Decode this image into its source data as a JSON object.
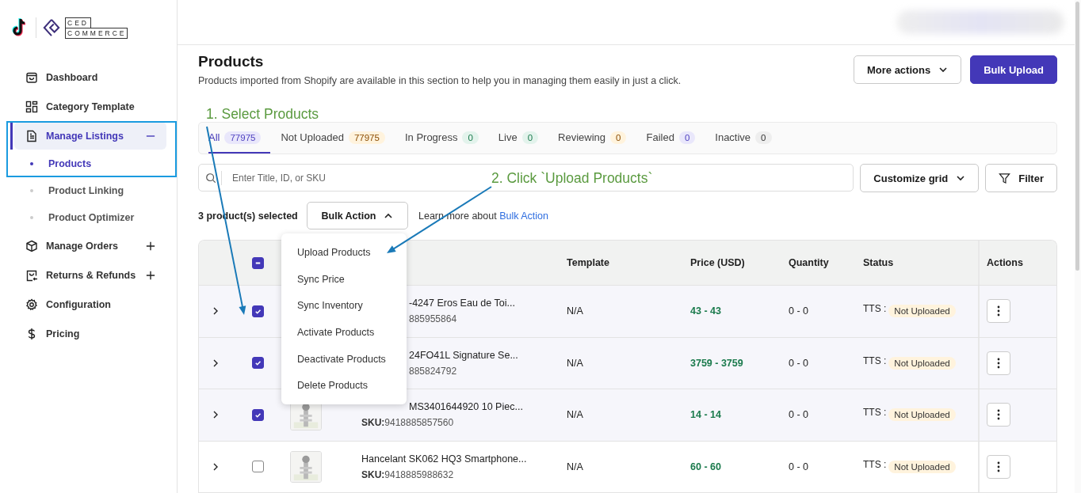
{
  "logo": {
    "line1": "CED",
    "line2": "COMMERCE"
  },
  "sidebar": {
    "items": [
      {
        "label": "Dashboard",
        "selected": false
      },
      {
        "label": "Category Template",
        "selected": false
      },
      {
        "label": "Manage Listings",
        "selected": true,
        "expanded": true,
        "children": [
          {
            "label": "Products",
            "selected": true
          },
          {
            "label": "Product Linking",
            "selected": false
          },
          {
            "label": "Product Optimizer",
            "selected": false
          }
        ]
      },
      {
        "label": "Manage Orders",
        "selected": false,
        "expanded": false
      },
      {
        "label": "Returns & Refunds",
        "selected": false,
        "expanded": false
      },
      {
        "label": "Configuration",
        "selected": false
      },
      {
        "label": "Pricing",
        "selected": false
      }
    ]
  },
  "page": {
    "title": "Products",
    "subtitle": "Products imported from Shopify are available in this section to help you in managing them easily in just a click.",
    "buttons": [
      {
        "label": "More actions",
        "kind": "dropdown"
      },
      {
        "label": "Bulk Upload",
        "kind": "primary"
      }
    ]
  },
  "tabs": [
    {
      "label": "All",
      "count": "77975",
      "selected": true,
      "color": "#e9e7fb"
    },
    {
      "label": "Not Uploaded",
      "count": "77975",
      "selected": false,
      "color": "#fff3dd"
    },
    {
      "label": "In Progress",
      "count": "0",
      "selected": false,
      "color": "#e3f3ec"
    },
    {
      "label": "Live",
      "count": "0",
      "selected": false,
      "color": "#e3f3ec"
    },
    {
      "label": "Reviewing",
      "count": "0",
      "selected": false,
      "color": "#fff3dd"
    },
    {
      "label": "Failed",
      "count": "0",
      "selected": false,
      "color": "#e9e7fb"
    },
    {
      "label": "Inactive",
      "count": "0",
      "selected": false,
      "color": "#eeeeee"
    }
  ],
  "search": {
    "placeholder": "Enter Title, ID, or SKU"
  },
  "toolbar_buttons": [
    {
      "label": "Customize grid",
      "kind": "dropdown"
    },
    {
      "label": "Filter",
      "kind": "filter"
    }
  ],
  "selection": {
    "count_text": "3 product(s) selected",
    "bulk_button": {
      "label": "Bulk Action",
      "expanded": true
    },
    "learn_more": "Learn more about",
    "learn_more_link": "Bulk Action"
  },
  "bulk_menu": [
    "Upload Products",
    "Sync Price",
    "Sync Inventory",
    "Activate Products",
    "Deactivate Products",
    "Delete Products"
  ],
  "table": {
    "select_all_checked": true,
    "select_all_partial": true,
    "columns": [
      "Template",
      "Price (USD)",
      "Quantity",
      "Status",
      "Actions"
    ],
    "rows": [
      {
        "checked": true,
        "image": false,
        "title": "-4247 Eros Eau de Toi...",
        "title_covered": true,
        "sku": "885955864",
        "template": "N/A",
        "price": "43 - 43",
        "quantity": "0 - 0",
        "status_prefix": "TTS :",
        "status": "Not Uploaded"
      },
      {
        "checked": true,
        "image": false,
        "title": "24FO41L Signature Se...",
        "title_covered": true,
        "sku": "885824792",
        "template": "N/A",
        "price": "3759 - 3759",
        "quantity": "0 - 0",
        "status_prefix": "TTS :",
        "status": "Not Uploaded"
      },
      {
        "checked": true,
        "image": true,
        "title": "MS3401644920 10 Piec...",
        "title_covered": true,
        "sku_label": "SKU:",
        "sku": "9418885857560",
        "template": "N/A",
        "price": "14 - 14",
        "quantity": "0 - 0",
        "status_prefix": "TTS :",
        "status": "Not Uploaded"
      },
      {
        "checked": false,
        "image": true,
        "title": "Hancelant SK062 HQ3 Smartphone...",
        "title_covered": false,
        "sku_label": "SKU:",
        "sku": "9418885988632",
        "template": "N/A",
        "price": "60 - 60",
        "quantity": "0 - 0",
        "status_prefix": "TTS :",
        "status": "Not Uploaded"
      }
    ]
  },
  "annotations": [
    {
      "kind": "frame"
    },
    {
      "kind": "text",
      "text": "1. Select Products"
    },
    {
      "kind": "arrow"
    },
    {
      "kind": "text",
      "text": "2. Click `Upload Products`"
    },
    {
      "kind": "arrow"
    }
  ]
}
